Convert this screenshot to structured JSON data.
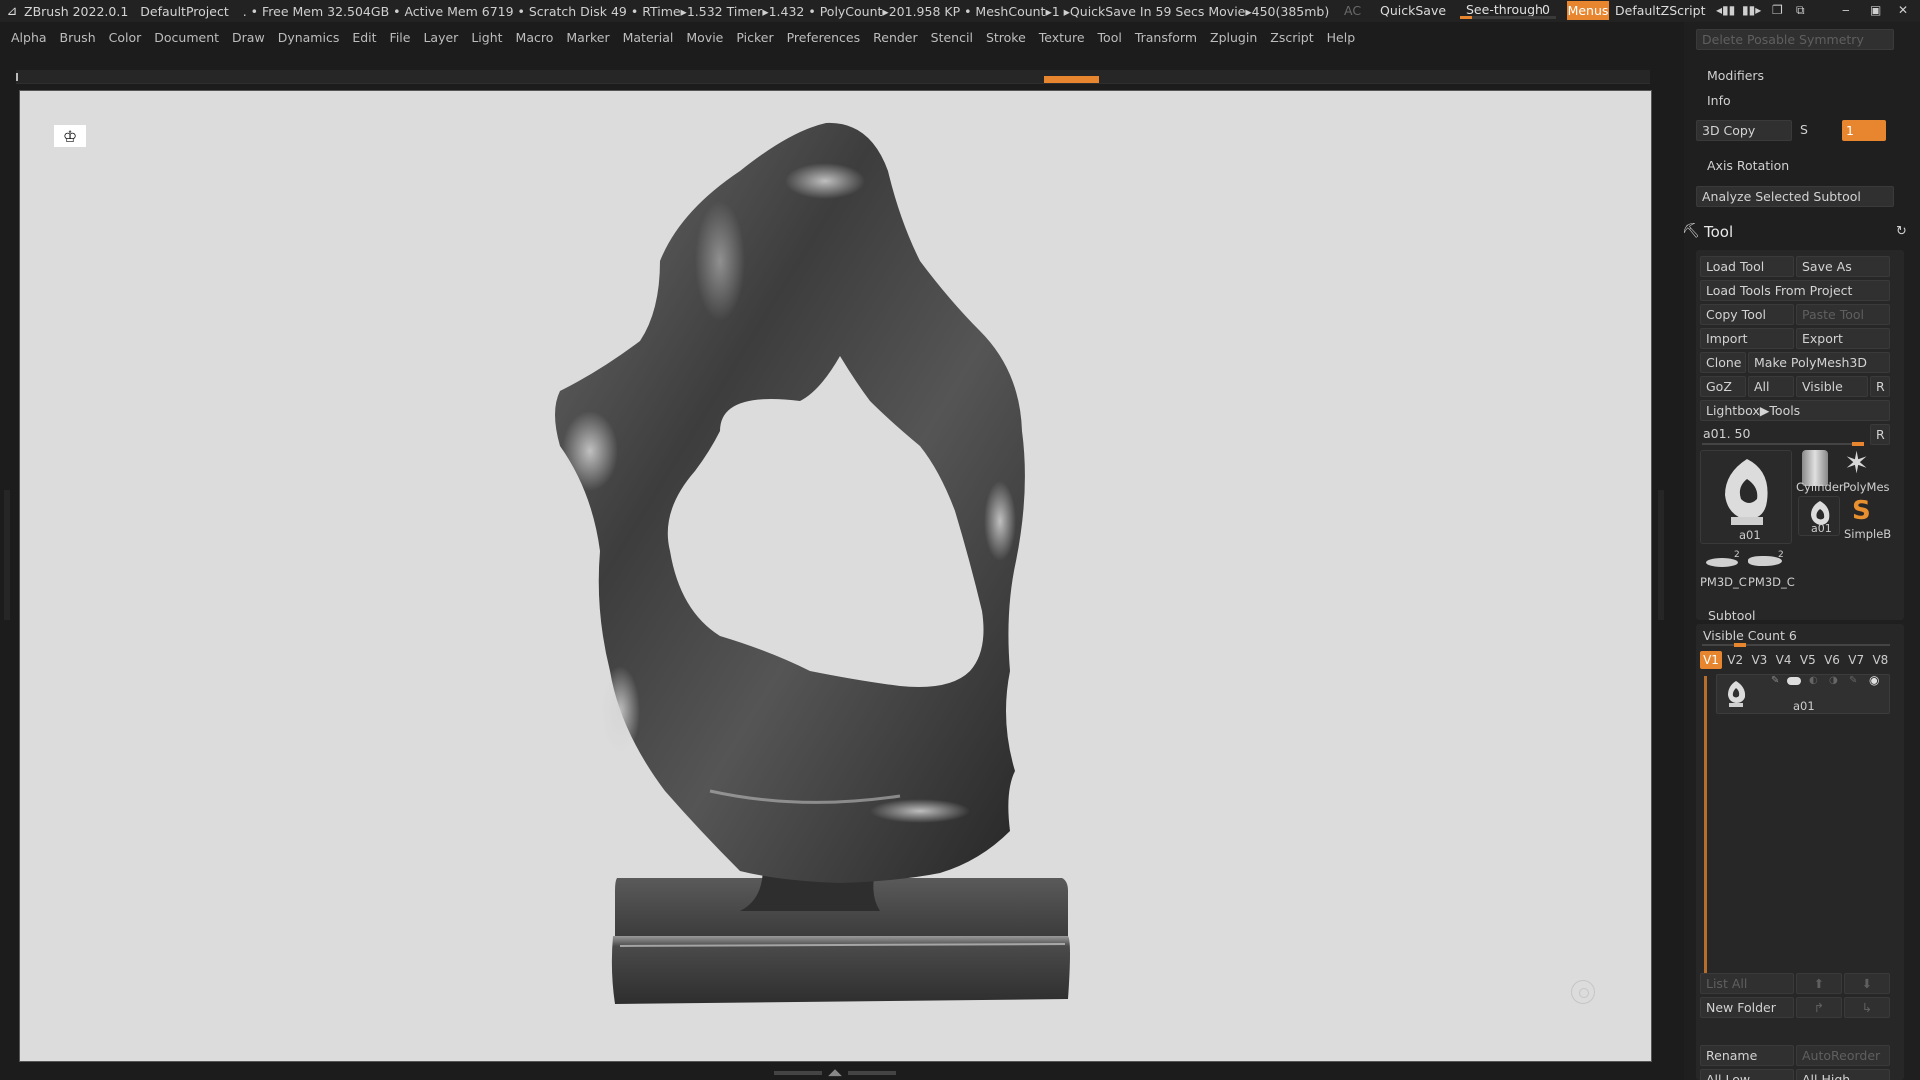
{
  "titlebar": {
    "app": "ZBrush 2022.0.1",
    "project": "DefaultProject",
    "stats": ". • Free Mem 32.504GB • Active Mem 6719 • Scratch Disk 49 •  RTime▸1.532 Timer▸1.432 • PolyCount▸201.958 KP  • MeshCount▸1   ▸QuickSave In 59 Secs Movie▸450(385mb)",
    "ac": "AC",
    "quicksave": "QuickSave",
    "seethrough_label": "See-through",
    "seethrough_value": "0",
    "seethrough_level": 0,
    "menus": "Menus",
    "script": "DefaultZScript"
  },
  "menubar": {
    "items": [
      "Alpha",
      "Brush",
      "Color",
      "Document",
      "Draw",
      "Dynamics",
      "Edit",
      "File",
      "Layer",
      "Light",
      "Macro",
      "Marker",
      "Material",
      "Movie",
      "Picker",
      "Preferences",
      "Render",
      "Stencil",
      "Stroke",
      "Texture",
      "Tool",
      "Transform",
      "Zplugin",
      "Zscript",
      "Help"
    ]
  },
  "rightpanel": {
    "delete_posable": "Delete Posable Symmetry",
    "modifiers": "Modifiers",
    "info": "Info",
    "copy3d": "3D Copy",
    "s_label": "S",
    "copy3d_value": "1",
    "axis_rotation": "Axis Rotation",
    "analyze": "Analyze Selected Subtool",
    "tool_title": "Tool",
    "load_tool": "Load Tool",
    "save_as": "Save As",
    "load_from_project": "Load Tools From Project",
    "copy_tool": "Copy Tool",
    "paste_tool": "Paste Tool",
    "import": "Import",
    "export": "Export",
    "clone": "Clone",
    "make_polymesh": "Make PolyMesh3D",
    "goz": "GoZ",
    "all": "All",
    "visible": "Visible",
    "r": "R",
    "lightbox_tools": "Lightbox▶Tools",
    "current_tool": "a01. 50",
    "r2": "R",
    "thumbs": {
      "main": "a01",
      "cylinder": "Cylinder",
      "polymesh": "PolyMes",
      "a01_small": "a01",
      "simpleb": "SimpleB",
      "pm1": "PM3D_C",
      "pm2": "PM3D_C",
      "pm_badge1": "2",
      "pm_badge2": "2"
    },
    "subtool": "Subtool",
    "visible_count_label": "Visible Count",
    "visible_count_value": "6",
    "vtabs": [
      "V1",
      "V2",
      "V3",
      "V4",
      "V5",
      "V6",
      "V7",
      "V8"
    ],
    "subtool_item": "a01",
    "list_all": "List All",
    "new_folder": "New Folder",
    "rename": "Rename",
    "auto_reorder": "AutoReorder",
    "all_low": "All Low",
    "all_high": "All High"
  },
  "colors": {
    "accent": "#e8862f",
    "viewport_bg": "#dcdcdc",
    "panel_bg": "#1f1f1f"
  }
}
